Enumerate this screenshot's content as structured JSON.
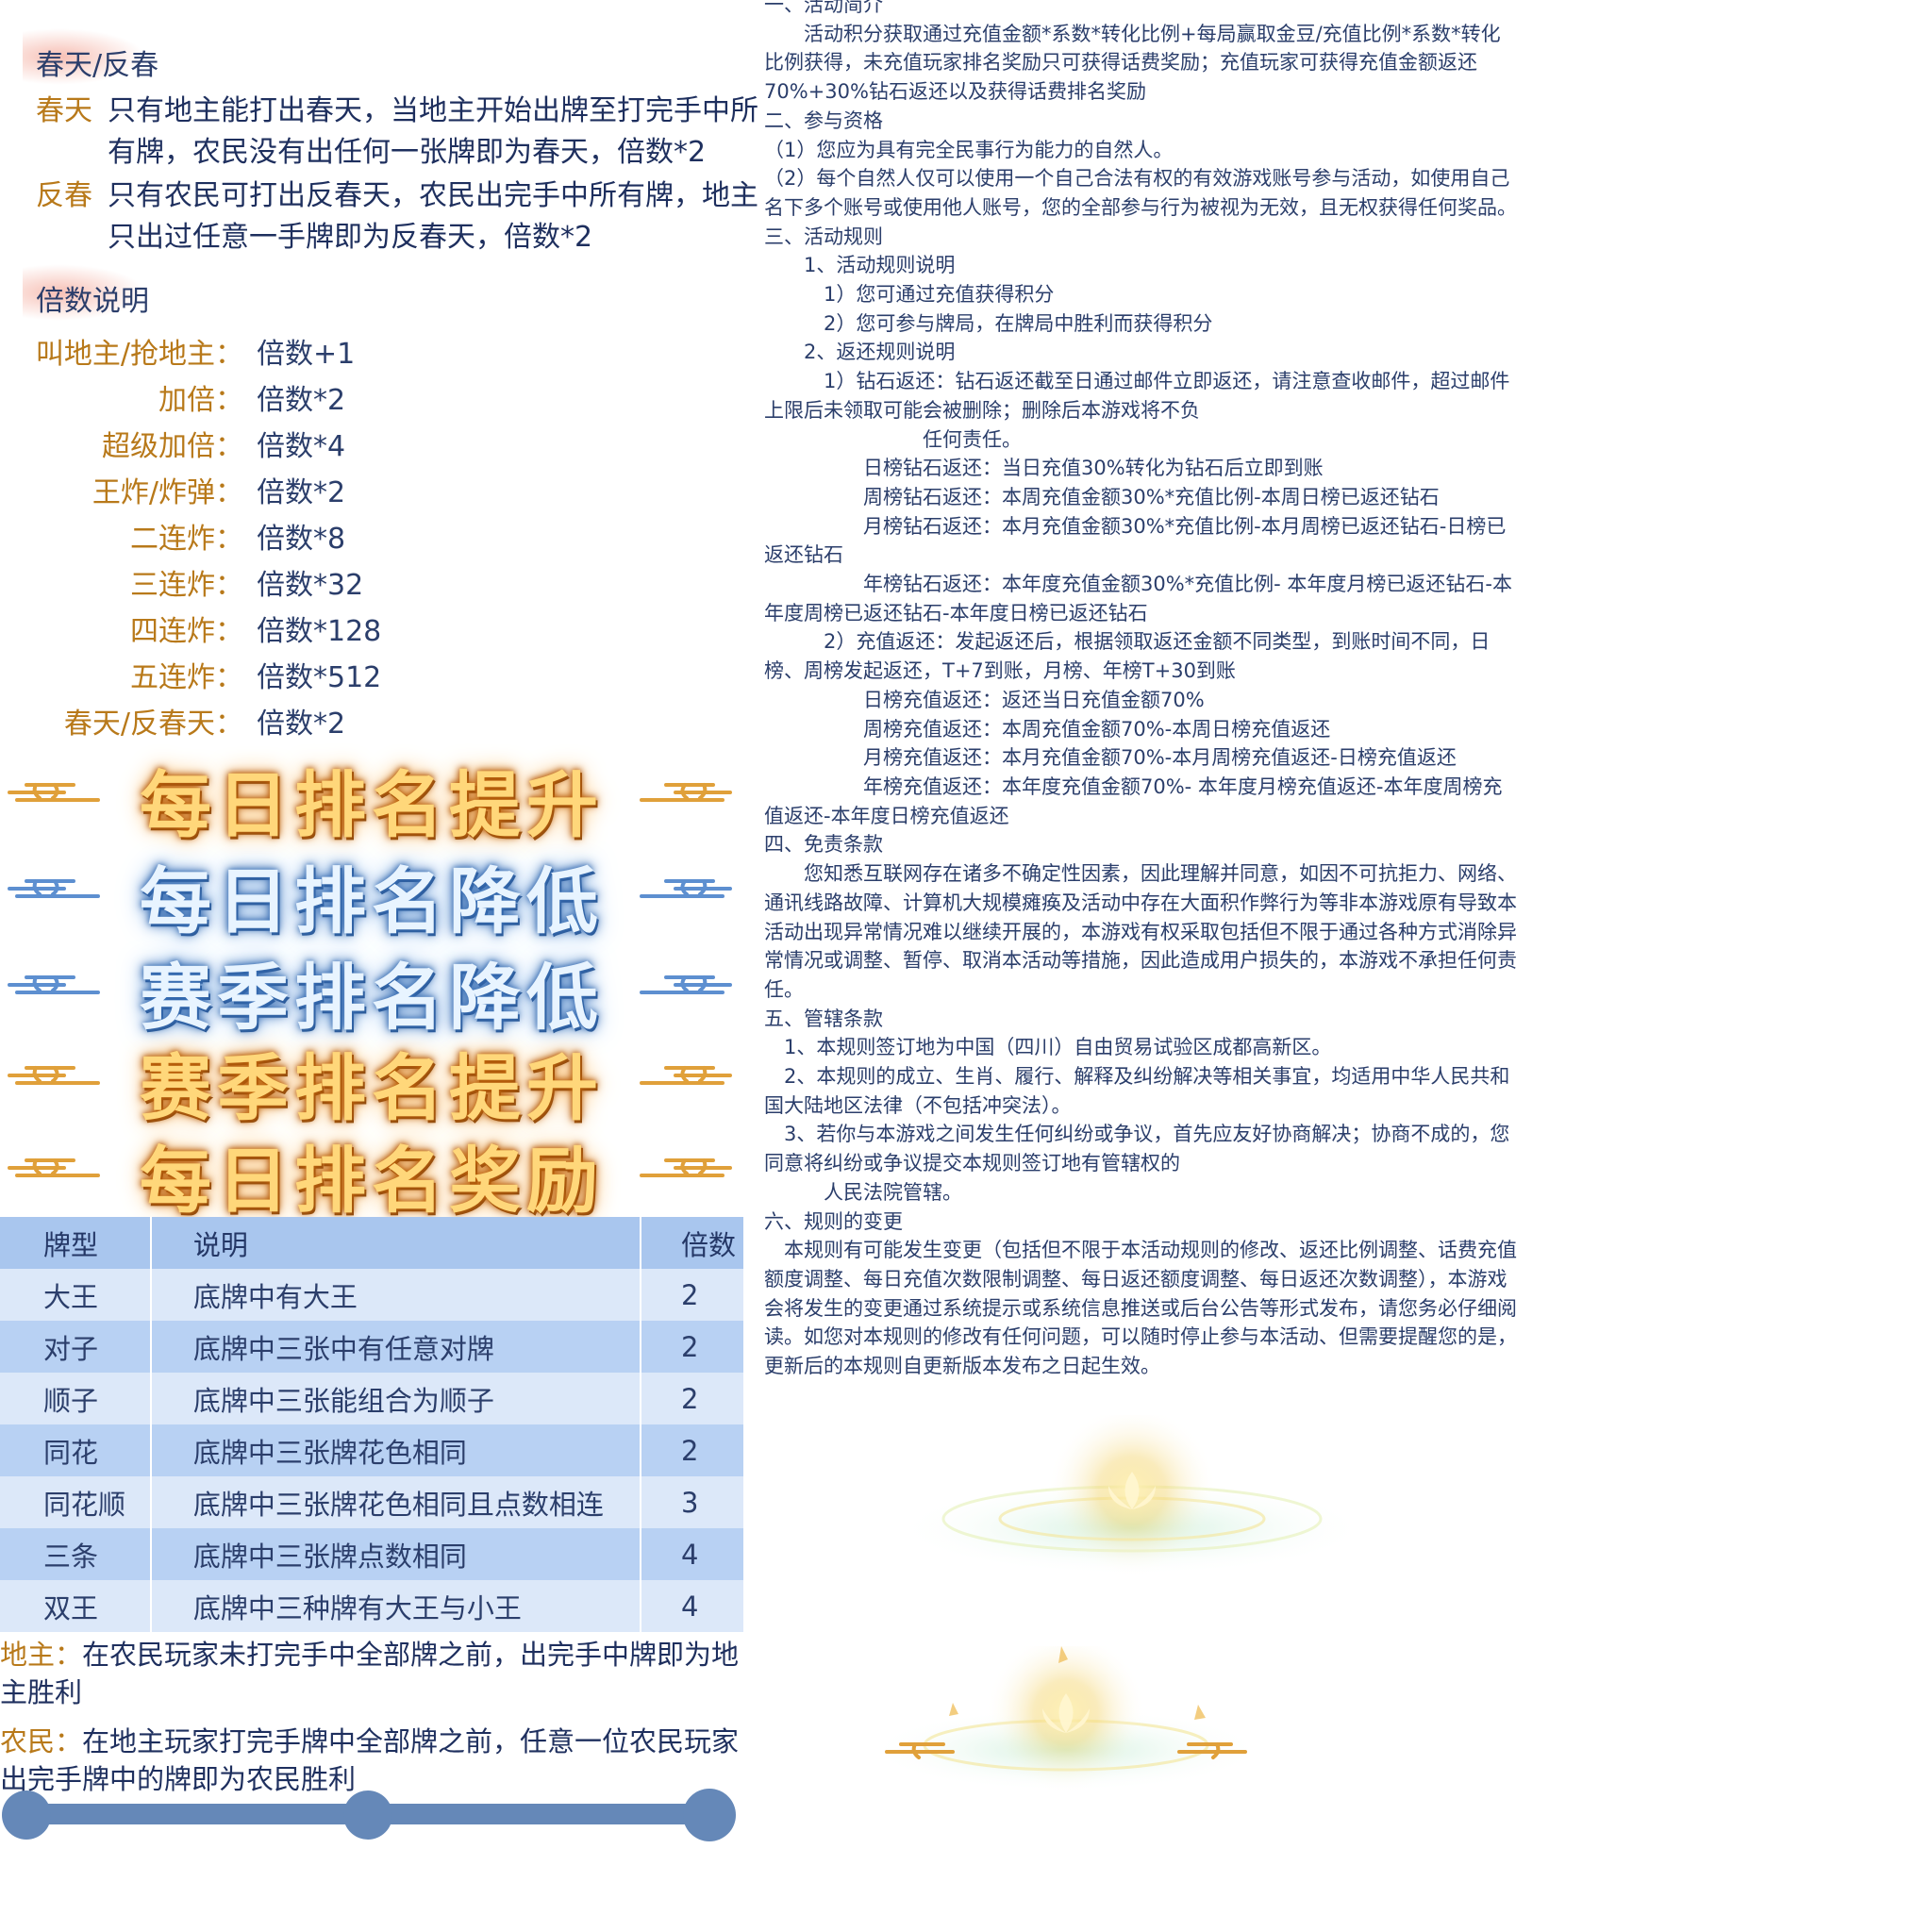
{
  "spring": {
    "title": "春天/反春",
    "items": [
      {
        "key": "春天",
        "text": "只有地主能打出春天，当地主开始出牌至打完手中所有牌，农民没有出任何一张牌即为春天，倍数*2"
      },
      {
        "key": "反春",
        "text": "只有农民可打出反春天，农民出完手中所有牌，地主只出过任意一手牌即为反春天，倍数*2"
      }
    ]
  },
  "multiplier": {
    "title": "倍数说明",
    "items": [
      {
        "key": "叫地主/抢地主：",
        "value": "倍数+1"
      },
      {
        "key": "加倍：",
        "value": "倍数*2"
      },
      {
        "key": "超级加倍：",
        "value": "倍数*4"
      },
      {
        "key": "王炸/炸弹：",
        "value": "倍数*2"
      },
      {
        "key": "二连炸：",
        "value": "倍数*8"
      },
      {
        "key": "三连炸：",
        "value": "倍数*32"
      },
      {
        "key": "四连炸：",
        "value": "倍数*128"
      },
      {
        "key": "五连炸：",
        "value": "倍数*512"
      },
      {
        "key": "春天/反春天：",
        "value": "倍数*2"
      }
    ]
  },
  "banners": [
    {
      "text": "每日排名提升",
      "style": "gold"
    },
    {
      "text": "每日排名降低",
      "style": "blue"
    },
    {
      "text": "赛季排名降低",
      "style": "blue"
    },
    {
      "text": "赛季排名提升",
      "style": "gold"
    },
    {
      "text": "每日排名奖励",
      "style": "gold"
    }
  ],
  "card_table": {
    "headers": [
      "牌型",
      "说明",
      "倍数"
    ],
    "rows": [
      [
        "大王",
        "底牌中有大王",
        "2"
      ],
      [
        "对子",
        "底牌中三张中有任意对牌",
        "2"
      ],
      [
        "顺子",
        "底牌中三张能组合为顺子",
        "2"
      ],
      [
        "同花",
        "底牌中三张牌花色相同",
        "2"
      ],
      [
        "同花顺",
        "底牌中三张牌花色相同且点数相连",
        "3"
      ],
      [
        "三条",
        "底牌中三张牌点数相同",
        "4"
      ],
      [
        "双王",
        "底牌中三种牌有大王与小王",
        "4"
      ]
    ]
  },
  "victory": [
    {
      "key": "地主：",
      "text": "在农民玩家未打完手中全部牌之前，出完手中牌即为地主胜利"
    },
    {
      "key": "农民：",
      "text": "在地主玩家打完手牌中全部牌之前，任意一位农民玩家出完手牌中的牌即为农民胜利"
    }
  ],
  "rules": [
    "一、活动简介",
    "　　活动积分获取通过充值金额*系数*转化比例+每局赢取金豆/充值比例*系数*转化比例获得，未充值玩家排名奖励只可获得话费奖励；充值玩家可获得充值金额返还70%+30%钻石返还以及获得话费排名奖励",
    "二、参与资格",
    "（1）您应为具有完全民事行为能力的自然人。",
    "（2）每个自然人仅可以使用一个自己合法有权的有效游戏账号参与活动，如使用自己名下多个账号或使用他人账号，您的全部参与行为被视为无效，且无权获得任何奖品。",
    "三、活动规则",
    "　　1、活动规则说明",
    "　　　1）您可通过充值获得积分",
    "　　　2）您可参与牌局，在牌局中胜利而获得积分",
    "　　2、返还规则说明",
    "　　　1）钻石返还：钻石返还截至日通过邮件立即返还，请注意查收邮件，超过邮件上限后未领取可能会被删除；删除后本游戏将不负",
    "　　　　　　　　任何责任。",
    "　　　　　日榜钻石返还：当日充值30%转化为钻石后立即到账",
    "　　　　　周榜钻石返还：本周充值金额30%*充值比例-本周日榜已返还钻石",
    "　　　　　月榜钻石返还：本月充值金额30%*充值比例-本月周榜已返还钻石-日榜已返还钻石",
    "　　　　　年榜钻石返还：本年度充值金额30%*充值比例- 本年度月榜已返还钻石-本年度周榜已返还钻石-本年度日榜已返还钻石",
    "　　　2）充值返还：发起返还后，根据领取返还金额不同类型，到账时间不同，日榜、周榜发起返还，T+7到账，月榜、年榜T+30到账",
    "　　　　　日榜充值返还：返还当日充值金额70%",
    "　　　　　周榜充值返还：本周充值金额70%-本周日榜充值返还",
    "　　　　　月榜充值返还：本月充值金额70%-本月周榜充值返还-日榜充值返还",
    "　　　　　年榜充值返还：本年度充值金额70%- 本年度月榜充值返还-本年度周榜充值返还-本年度日榜充值返还",
    "四、免责条款",
    "　　您知悉互联网存在诸多不确定性因素，因此理解并同意，如因不可抗拒力、网络、通讯线路故障、计算机大规模瘫痪及活动中存在大面积作弊行为等非本游戏原有导致本活动出现异常情况难以继续开展的，本游戏有权采取包括但不限于通过各种方式消除异常情况或调整、暂停、取消本活动等措施，因此造成用户损失的，本游戏不承担任何责任。",
    "五、管辖条款",
    "　1、本规则签订地为中国（四川）自由贸易试验区成都高新区。",
    "　2、本规则的成立、生肖、履行、解释及纠纷解决等相关事宜，均适用中华人民共和国大陆地区法律（不包括冲突法）。",
    "　3、若你与本游戏之间发生任何纠纷或争议，首先应友好协商解决；协商不成的，您同意将纠纷或争议提交本规则签订地有管辖权的",
    "　　　人民法院管辖。",
    "六、规则的变更",
    "　本规则有可能发生变更（包括但不限于本活动规则的修改、返还比例调整、话费充值额度调整、每日充值次数限制调整、每日返还额度调整、每日返还次数调整），本游戏会将发生的变更通过系统提示或系统信息推送或后台公告等形式发布，请您务必仔细阅读。如您对本规则的修改有任何问题，可以随时停止参与本活动、但需要提醒您的是，更新后的本规则自更新版本发布之日起生效。"
  ],
  "colors": {
    "accent_gold": "#b8791a",
    "text_navy": "#2b3e6b",
    "table_header": "#a9c6ee",
    "table_light": "#dce8f9",
    "table_dark": "#b8d1f3",
    "bar": "#6588b8"
  },
  "icons": [
    "cloud-ornament-icon",
    "lotus-glow-icon",
    "scroll-bar-icon"
  ]
}
